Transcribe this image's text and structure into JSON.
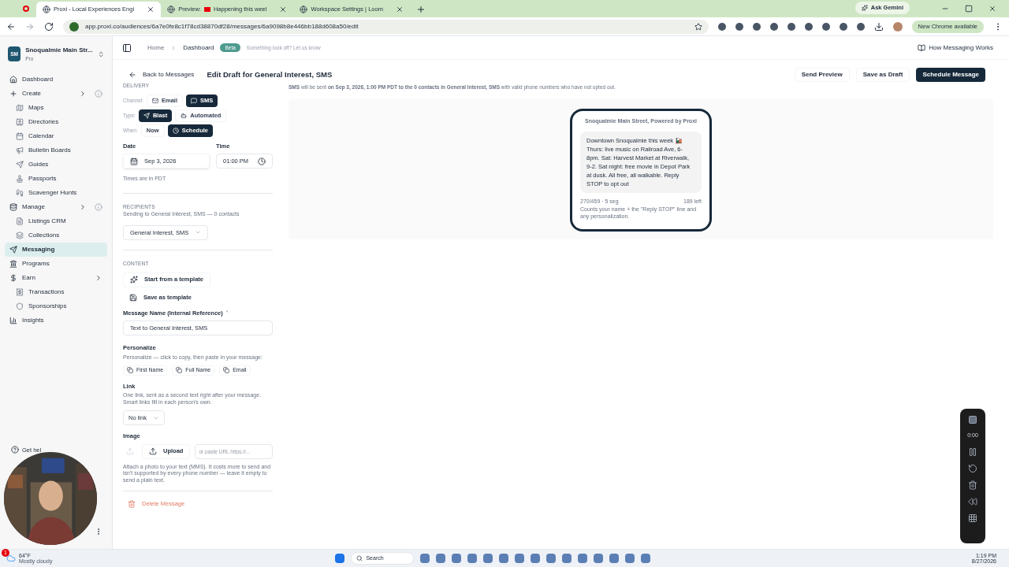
{
  "browser": {
    "tabs": [
      {
        "title": "Proxi - Local Experiences Engi",
        "selected": true
      },
      {
        "prefix": "Preview:",
        "title": "Happening this weel",
        "selected": false
      },
      {
        "title": "Workspace Settings | Loom",
        "selected": false
      }
    ],
    "address": "app.proxi.co/audiences/6a7e0fe8c1f78cd38870df28/messages/6a9098b8e446bb188d608a50/edit",
    "gemini": "Ask Gemini",
    "update": "New Chrome available"
  },
  "workspace": {
    "initials": "SM",
    "name": "Snoqualmie Main Str...",
    "plan": "Pro"
  },
  "sidebar": {
    "items": [
      {
        "label": "Dashboard",
        "selected": false,
        "info": false
      },
      {
        "label": "Create",
        "selected": false,
        "info": true,
        "children": [
          {
            "label": "Maps",
            "selected": false
          },
          {
            "label": "Directories",
            "selected": false
          },
          {
            "label": "Calendar",
            "selected": false
          },
          {
            "label": "Bulletin Boards",
            "selected": false
          },
          {
            "label": "Guides",
            "selected": false
          },
          {
            "label": "Passports",
            "selected": false
          },
          {
            "label": "Scavenger Hunts",
            "selected": false
          }
        ]
      },
      {
        "label": "Manage",
        "selected": false,
        "info": true,
        "children": [
          {
            "label": "Listings CRM",
            "selected": false
          },
          {
            "label": "Collections",
            "selected": false
          }
        ]
      },
      {
        "label": "Messaging",
        "selected": true,
        "info": false
      },
      {
        "label": "Programs",
        "selected": false,
        "info": false
      },
      {
        "label": "Earn",
        "selected": false,
        "info": false,
        "children": [
          {
            "label": "Transactions",
            "selected": false
          },
          {
            "label": "Sponsorships",
            "selected": false
          }
        ]
      },
      {
        "label": "Insights",
        "selected": false,
        "info": false
      }
    ],
    "help": "Get hel"
  },
  "topbar": {
    "breadcrumbs": [
      "Home",
      "Dashboard"
    ],
    "badge": "Beta",
    "feedback": "Something look off? Let us know",
    "guide": "How Messaging Works"
  },
  "header": {
    "back": "Back to Messages",
    "title": "Edit Draft for General Interest, SMS",
    "actions": [
      {
        "label": "Send Preview",
        "primary": false
      },
      {
        "label": "Save as Draft",
        "primary": false
      },
      {
        "label": "Schedule Message",
        "primary": true
      }
    ]
  },
  "delivery": {
    "heading": "DELIVERY",
    "rows": [
      {
        "label": "Channel:",
        "options": [
          {
            "label": "Email",
            "selected": false
          },
          {
            "label": "SMS",
            "selected": true
          }
        ]
      },
      {
        "label": "Type:",
        "options": [
          {
            "label": "Blast",
            "selected": true
          },
          {
            "label": "Automated",
            "selected": false
          }
        ]
      },
      {
        "label": "When:",
        "options": [
          {
            "label": "Now",
            "selected": false
          },
          {
            "label": "Schedule",
            "selected": true
          }
        ]
      }
    ],
    "date_label": "Date",
    "date": "Sep 3, 2026",
    "time_label": "Time",
    "time": "01:00 PM",
    "tz_note": "Times are in PDT"
  },
  "recipients": {
    "heading": "RECIPIENTS",
    "note": "Sending to General Interest, SMS — 0 contacts",
    "audience": "General Interest, SMS"
  },
  "content": {
    "heading": "CONTENT",
    "template_button": "Start from a template",
    "save_template": "Save as template",
    "name_label": "Message Name (Internal Reference)",
    "required": "*",
    "name_value": "Text to General Interest, SMS",
    "personalize_label": "Personalize",
    "personalize_note": "Personalize — click to copy, then paste in your message:",
    "tokens": [
      "First Name",
      "Full Name",
      "Email"
    ],
    "link_label": "Link",
    "link_note": "One link, sent as a second text right after your message. Smart links fill in each person's own.",
    "link_value": "No link",
    "image_label": "Image",
    "upload": "Upload",
    "url_placeholder": "or paste URL https://...",
    "image_note": "Attach a photo to your text (MMS). It costs more to send and isn't supported by every phone number — leave it empty to send a plain text.",
    "delete": "Delete Message"
  },
  "preview": {
    "summary": "**SMS** will be sent **on Sep 3, 2026, 1:00 PM PDT to the 0 contacts in General Interest, SMS** with valid phone numbers who have not opted out.",
    "sender": "Snoqualmie Main Street, Powered by Proxi",
    "body": "Downtown Snoqualmie this week 🚂 Thurs: live music on Railroad Ave, 6-8pm. Sat: Harvest Market at Riverwalk, 9-2. Sat night: free movie in Depot Park at dusk. All free, all walkable. Reply STOP to opt out",
    "count": "270/459 · 5 seg",
    "left": "189 left",
    "count_note": "Counts your name + the \"Reply STOP\" line and any personalization."
  },
  "recorder": {
    "timer": "0:00"
  },
  "taskbar": {
    "temperature": "64°F",
    "weather": "Mostly cloudy",
    "alerts": "1",
    "search": "Search",
    "time": "1:19 PM",
    "date": "8/27/2026"
  }
}
